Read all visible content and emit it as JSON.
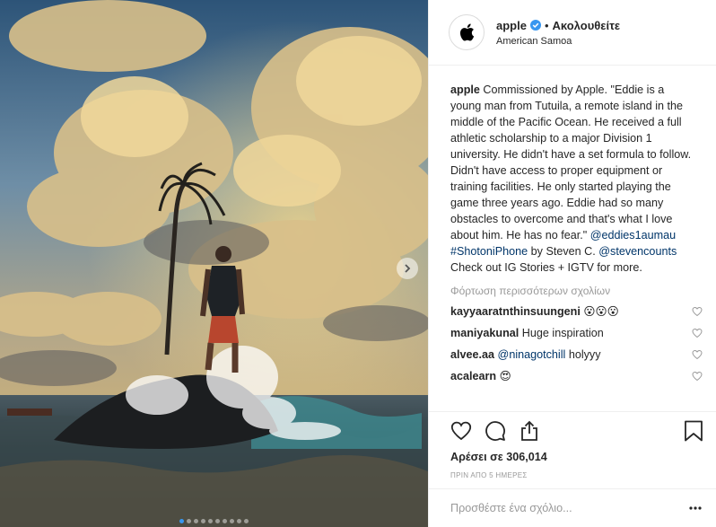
{
  "post": {
    "header": {
      "avatar_icon": "apple-logo-icon",
      "username": "apple",
      "verified_icon": "verified-badge-icon",
      "separator": "•",
      "follow_label": "Ακολουθείτε",
      "location": "American Samoa"
    },
    "caption": {
      "username": "apple",
      "text1": " Commissioned by Apple. \"Eddie is a young man from Tutuila, a remote island in the middle of the Pacific Ocean. He received a full athletic scholarship to a major Division 1 university. He didn't have a set formula to follow. Didn't have access to proper equipment or training facilities. He only started playing the game three years ago. Eddie had so many obstacles to overcome and that's what I love about him. He has no fear.\" ",
      "mention1": "@eddies1aumau",
      "hashtag": "#ShotoniPhone",
      "text2": " by Steven C. ",
      "mention2": "@stevencounts",
      "text3": " Check out IG Stories + IGTV for more."
    },
    "load_more_label": "Φόρτωση περισσότερων σχολίων",
    "comments": [
      {
        "username": "kayyaaratnthinsuungeni",
        "text": " 😮😮😮"
      },
      {
        "username": "maniyakunal",
        "text": " Huge inspiration"
      },
      {
        "username": "alvee.aa",
        "mention": "@ninagotchill",
        "text": " holyyy"
      },
      {
        "username": "acalearn",
        "text": " 😍"
      }
    ],
    "actions": {
      "like_icon": "heart-icon",
      "comment_icon": "comment-bubble-icon",
      "share_icon": "share-icon",
      "save_icon": "bookmark-icon"
    },
    "likes_text": "Αρέσει σε 306,014",
    "time_text": "ΠΡΙΝ ΑΠΟ 5 ΗΜΕΡΕΣ",
    "add_comment_placeholder": "Προσθέστε ένα σχόλιο...",
    "more_options_icon": "more-dots-icon",
    "carousel": {
      "total_slides": 10,
      "active_slide": 1,
      "next_icon": "chevron-right-icon"
    },
    "colors": {
      "accent": "#3897f0",
      "link": "#003569",
      "text": "#262626",
      "muted": "#999999",
      "border": "#efefef"
    }
  }
}
